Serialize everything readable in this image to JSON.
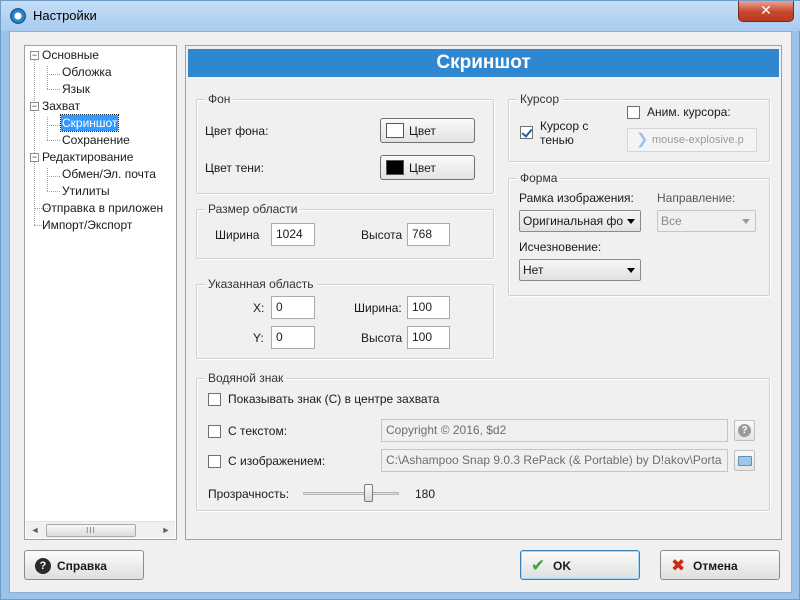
{
  "window": {
    "title": "Настройки",
    "close_symbol": "✕"
  },
  "tree": {
    "items": [
      {
        "label": "Основные"
      },
      {
        "label": "Обложка"
      },
      {
        "label": "Язык"
      },
      {
        "label": "Захват"
      },
      {
        "label": "Скриншот"
      },
      {
        "label": "Сохранение"
      },
      {
        "label": "Редактирование"
      },
      {
        "label": "Обмен/Эл. почта"
      },
      {
        "label": "Утилиты"
      },
      {
        "label": "Отправка в приложен"
      },
      {
        "label": "Импорт/Экспорт"
      }
    ],
    "selected": "Скриншот",
    "scroll": {
      "left": "◄",
      "right": "►",
      "grip": "III"
    }
  },
  "panel": {
    "title": "Скриншот",
    "background": {
      "title": "Фон",
      "bg_color_label": "Цвет фона:",
      "shadow_color_label": "Цвет тени:",
      "color_button_label": "Цвет",
      "bg_color": "#ffffff",
      "shadow_color": "#000000"
    },
    "cursor": {
      "title": "Курсор",
      "cursor_with_shadow": "Курсор с тенью",
      "cursor_with_shadow_checked": true,
      "animate_cursor": "Аним. курсора:",
      "animate_cursor_checked": false,
      "cursor_file": "mouse-explosive.p"
    },
    "area_size": {
      "title": "Размер области",
      "width_label": "Ширина",
      "width_value": "1024",
      "height_label": "Высота",
      "height_value": "768"
    },
    "specified_area": {
      "title": "Указанная область",
      "x_label": "X:",
      "x_value": "0",
      "y_label": "Y:",
      "y_value": "0",
      "width_label": "Ширина:",
      "width_value": "100",
      "height_label": "Высота",
      "height_value": "100"
    },
    "shape": {
      "title": "Форма",
      "frame_label": "Рамка изображения:",
      "frame_value": "Оригинальная фо",
      "direction_label": "Направление:",
      "direction_value": "Все",
      "fade_label": "Исчезновение:",
      "fade_value": "Нет"
    },
    "watermark": {
      "title": "Водяной знак",
      "show_center": "Показывать знак (С) в центре захвата",
      "with_text": "С текстом:",
      "text_value": "Copyright © 2016, $d2",
      "with_image": "С изображением:",
      "image_value": "C:\\Ashampoo Snap 9.0.3 RePack (& Portable) by D!akov\\Porta",
      "opacity_label": "Прозрачность:",
      "opacity_value": "180",
      "opacity_fraction": 0.7
    }
  },
  "buttons": {
    "help": "Справка",
    "ok": "OK",
    "cancel": "Отмена",
    "help_icon": "?",
    "ok_icon": "✔",
    "cancel_icon": "✖"
  },
  "colors": {
    "accent": "#2f87cf",
    "selection": "#3399ff"
  }
}
